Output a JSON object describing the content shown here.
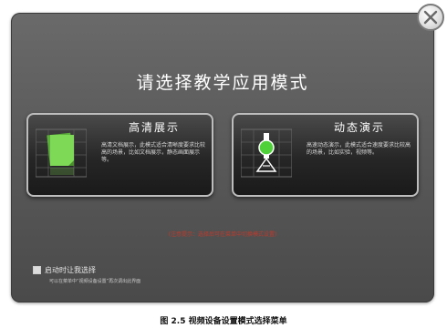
{
  "dialog": {
    "title": "请选择教学应用模式",
    "close_icon": "close-icon"
  },
  "modes": [
    {
      "title": "高清展示",
      "description": "高清文档展示，此模式适合清晰度要求比较高的场景，比如文档展示，静态画面展示等。",
      "icon": "document-icon"
    },
    {
      "title": "动态演示",
      "description": "高速动态演示，此模式适合速度要求比较高的场景，比如实验，视频等。",
      "icon": "flask-icon"
    }
  ],
  "notice": "(注意提示：选择后可在菜单中切换模式设置)",
  "startup": {
    "checked": false,
    "label": "启动时让我选择",
    "hint": "可以在菜单中“视频设备设置”再次调出此界面"
  },
  "caption": "图 2.5  视频设备设置模式选择菜单",
  "colors": {
    "dialog_bg": "#5a5a5a",
    "card_bg": "#262626",
    "document_green": "#7ed957",
    "notice_red": "#c0392b"
  }
}
